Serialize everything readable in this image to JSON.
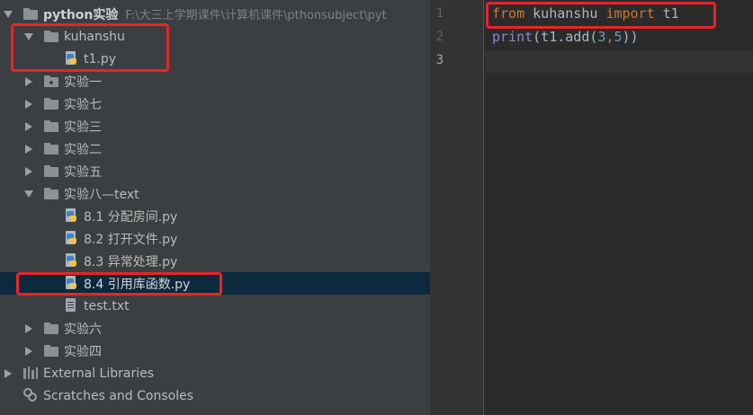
{
  "project_tree": {
    "root": {
      "name": "python实验",
      "path": "F:\\大三上学期课件\\计算机课件\\pthonsubject\\pyt"
    },
    "folder_kuhanshu": "kuhanshu",
    "file_t1": "t1.py",
    "folder_1": "实验一",
    "folder_7": "实验七",
    "folder_3": "实验三",
    "folder_2": "实验二",
    "folder_5": "实验五",
    "folder_8": "实验八—text",
    "file_81": "8.1 分配房间.py",
    "file_82": "8.2 打开文件.py",
    "file_83": "8.3 异常处理.py",
    "file_84": "8.4 引用库函数.py",
    "file_test": "test.txt",
    "folder_6": "实验六",
    "folder_4": "实验四",
    "external_libraries": "External Libraries",
    "scratches": "Scratches and Consoles"
  },
  "editor": {
    "line_numbers": [
      "1",
      "2",
      "3"
    ],
    "line1": {
      "kw_from": "from",
      "module": " kuhanshu ",
      "kw_import": "import",
      "name": " t1"
    },
    "line2": {
      "builtin_print": "print",
      "call": "(t1.add(",
      "arg1": "3",
      "comma": ",",
      "arg2": "5",
      "close": "))"
    }
  },
  "colors": {
    "highlight_box": "#e8242a",
    "keyword": "#cc7832",
    "builtin": "#8888c6",
    "number": "#6897bb",
    "selection": "#0d293e"
  }
}
